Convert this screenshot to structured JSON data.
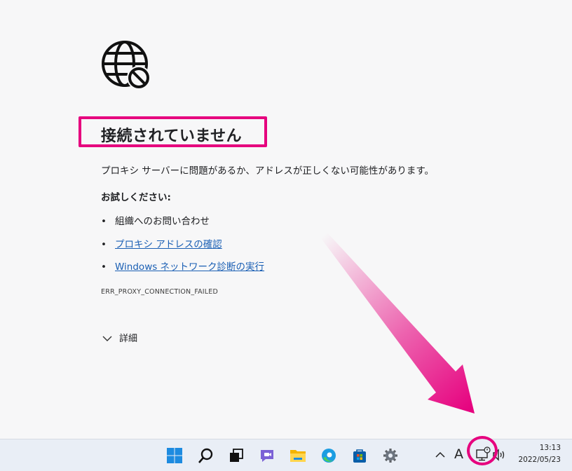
{
  "error_page": {
    "title": "接続されていません",
    "description": "プロキシ サーバーに問題があるか、アドレスが正しくない可能性があります。",
    "try_heading": "お試しください:",
    "suggestions": [
      {
        "bullet": "•",
        "text": "組織へのお問い合わせ",
        "link": false
      },
      {
        "bullet": "•",
        "text": "プロキシ アドレスの確認",
        "link": true
      },
      {
        "bullet": "•",
        "text": "Windows ネットワーク診断の実行",
        "link": true
      }
    ],
    "error_code": "ERR_PROXY_CONNECTION_FAILED",
    "details_label": "詳細"
  },
  "taskbar": {
    "apps": [
      {
        "name": "start-icon"
      },
      {
        "name": "search-icon"
      },
      {
        "name": "task-view-icon"
      },
      {
        "name": "chat-icon"
      },
      {
        "name": "file-explorer-icon"
      },
      {
        "name": "edge-icon"
      },
      {
        "name": "store-icon"
      },
      {
        "name": "settings-icon"
      }
    ],
    "ime_indicator": "A",
    "clock_time": "13:13",
    "clock_date": "2022/05/23"
  },
  "colors": {
    "highlight": "#e6007e",
    "link": "#1a5fb4",
    "background": "#f7f7f8",
    "taskbar": "#e9eef6"
  }
}
